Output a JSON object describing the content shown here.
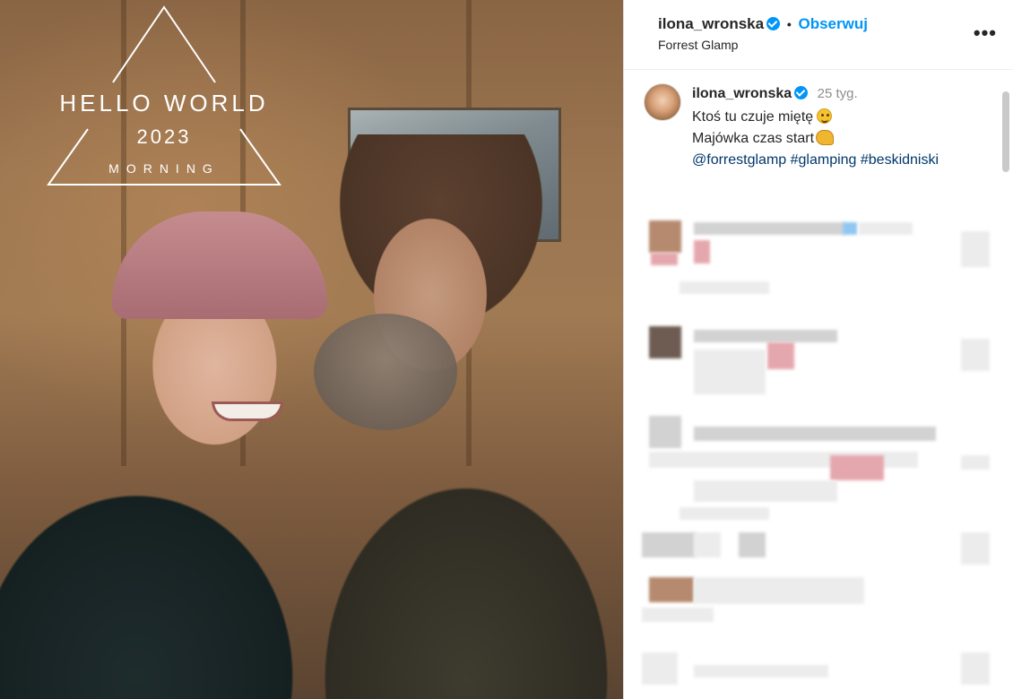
{
  "photo": {
    "overlay": {
      "line1": "HELLO WORLD",
      "line2": "2023",
      "line3": "MORNING"
    }
  },
  "header": {
    "username": "ilona_wronska",
    "separator": "•",
    "follow_label": "Obserwuj",
    "location": "Forrest Glamp",
    "more_icon": "more-horizontal-icon",
    "more_glyph": "•••"
  },
  "caption": {
    "username": "ilona_wronska",
    "time": "25 tyg.",
    "line1": "Ktoś tu czuje miętę",
    "line2": "Majówka czas start",
    "line3": "@forrestglamp #glamping #beskidniski"
  },
  "colors": {
    "accent": "#0095f6",
    "link": "#00376b",
    "muted": "#8e8e8e"
  }
}
